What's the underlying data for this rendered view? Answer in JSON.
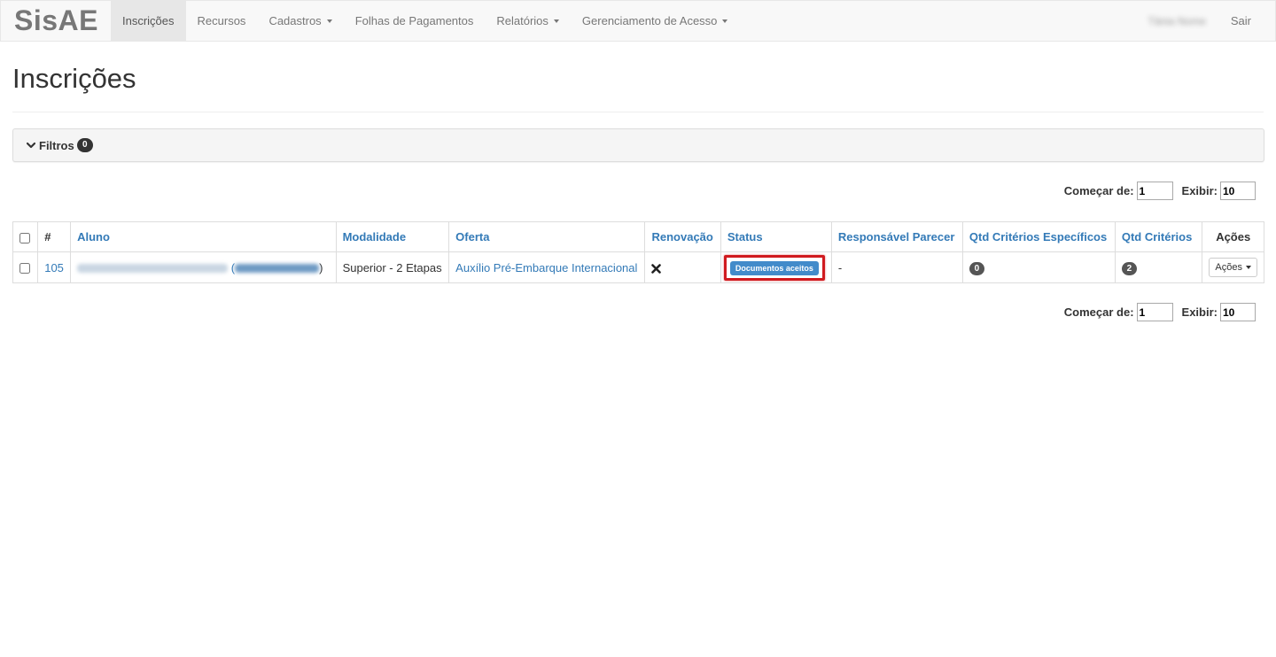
{
  "navbar": {
    "brand": "SisAE",
    "items": [
      {
        "label": "Inscrições",
        "active": true,
        "dropdown": false
      },
      {
        "label": "Recursos",
        "active": false,
        "dropdown": false
      },
      {
        "label": "Cadastros",
        "active": false,
        "dropdown": true
      },
      {
        "label": "Folhas de Pagamentos",
        "active": false,
        "dropdown": false
      },
      {
        "label": "Relatórios",
        "active": false,
        "dropdown": true
      },
      {
        "label": "Gerenciamento de Acesso",
        "active": false,
        "dropdown": true
      }
    ],
    "user_name": "Tânia Nome",
    "logout_label": "Sair"
  },
  "page": {
    "title": "Inscrições"
  },
  "filters": {
    "label": "Filtros",
    "count": "0",
    "icon": "chevron-down-icon"
  },
  "pagination": {
    "start_label": "Começar de:",
    "start_value": "1",
    "show_label": "Exibir:",
    "show_value": "10"
  },
  "table": {
    "headers": {
      "num": "#",
      "aluno": "Aluno",
      "modalidade": "Modalidade",
      "oferta": "Oferta",
      "renovacao": "Renovação",
      "status": "Status",
      "responsavel": "Responsável Parecer",
      "qtd_especificos": "Qtd Critérios Específicos",
      "qtd_criterios": "Qtd Critérios",
      "acoes": "Ações"
    },
    "rows": [
      {
        "id": "105",
        "aluno_open": "(",
        "aluno_close": ")",
        "modalidade": "Superior - 2 Etapas",
        "oferta": "Auxílio Pré-Embarque Internacional",
        "renovacao_icon": "x-mark-icon",
        "status": "Documentos aceitos",
        "responsavel": "-",
        "qtd_especificos": "0",
        "qtd_criterios": "2",
        "acoes_label": "Ações"
      }
    ]
  },
  "colors": {
    "link": "#337ab7",
    "status_label": "#428bca",
    "highlight_border": "#d01a1f",
    "navbar_bg": "#f8f8f8"
  }
}
